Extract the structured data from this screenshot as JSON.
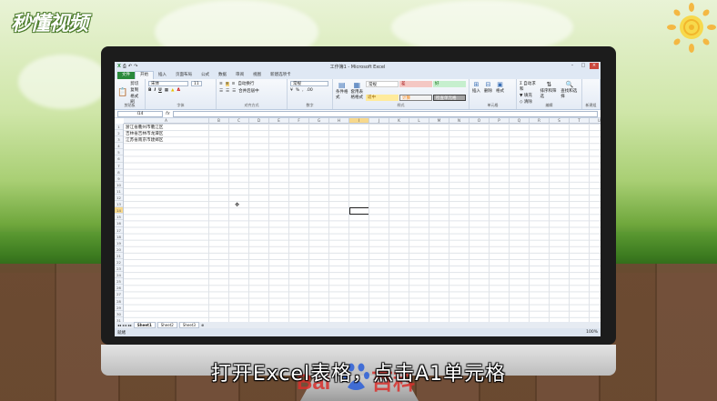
{
  "brand": {
    "logo_text": "秒懂视频",
    "watermark_text": "Baidu 百科"
  },
  "window": {
    "title": "工作簿1 - Microsoft Excel",
    "buttons": [
      "–",
      "□",
      "×"
    ]
  },
  "qat": [
    "⎙",
    "↶",
    "↷"
  ],
  "tabs": [
    "文件",
    "开始",
    "插入",
    "页面布局",
    "公式",
    "数据",
    "审阅",
    "视图",
    "新建选项卡"
  ],
  "ribbon": {
    "clipboard": {
      "cut": "剪切",
      "copy": "复制",
      "painter": "格式刷",
      "paste": "粘贴",
      "label": "剪贴板"
    },
    "font": {
      "name": "宋体",
      "size": "11",
      "label": "字体"
    },
    "align": {
      "wrap": "自动换行",
      "merge": "合并后居中",
      "label": "对齐方式"
    },
    "number": {
      "format": "常规",
      "label": "数字"
    },
    "styles": {
      "cond": "条件格式",
      "table": "套用表格格式",
      "normal": "常规",
      "bad": "差",
      "good": "好",
      "neutral": "适中",
      "calc": "计算",
      "check": "检查单元格",
      "label": "样式"
    },
    "cells": {
      "insert": "插入",
      "delete": "删除",
      "format": "格式",
      "label": "单元格"
    },
    "editing": {
      "autosum": "自动求和",
      "fill": "填充",
      "clear": "清除",
      "sort": "排序和筛选",
      "find": "查找和选择",
      "label": "编辑"
    },
    "newgroup": {
      "label": "新建组"
    }
  },
  "formula_bar": {
    "name_box": "I14",
    "fx": "fx",
    "value": ""
  },
  "columns": [
    "A",
    "B",
    "C",
    "D",
    "E",
    "F",
    "G",
    "H",
    "I",
    "J",
    "K",
    "L",
    "M",
    "N",
    "O",
    "P",
    "Q",
    "R",
    "S",
    "T",
    "U",
    "V"
  ],
  "rows": [
    "1",
    "2",
    "3",
    "4",
    "5",
    "6",
    "7",
    "8",
    "9",
    "10",
    "11",
    "12",
    "13",
    "14",
    "15",
    "16",
    "17",
    "18",
    "19",
    "20",
    "21",
    "22",
    "23",
    "24",
    "25",
    "26",
    "27",
    "28",
    "29",
    "30",
    "31"
  ],
  "cells": {
    "A1": "浙江省衢州市衢江区",
    "A2": "吉林省吉林市龙潭区",
    "A3": "江苏省南京市建邺区"
  },
  "active_cell": {
    "column": "I",
    "row": "14"
  },
  "sheets": [
    "Sheet1",
    "Sheet2",
    "Sheet3"
  ],
  "status": {
    "left": "就绪",
    "zoom": "100%"
  },
  "caption": "打开Excel表格，点击A1单元格"
}
